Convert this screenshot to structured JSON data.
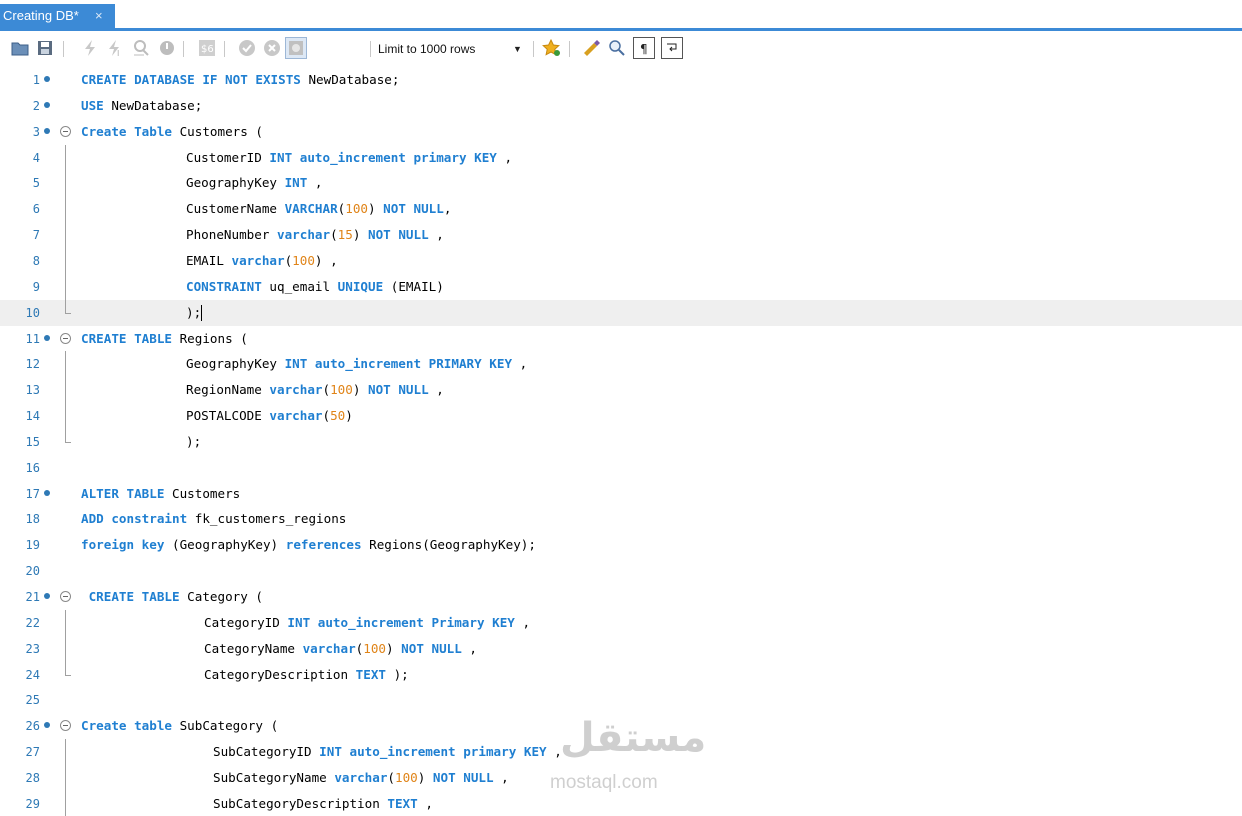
{
  "tab": {
    "title": "Creating DB*",
    "close": "×"
  },
  "toolbar": {
    "limit_label": "Limit to 1000 rows",
    "icons": [
      "open-folder-icon",
      "save-icon",
      "execute-icon",
      "execute-current-icon",
      "explain-icon",
      "stop-icon",
      "toggle-output-icon",
      "commit-icon",
      "rollback-icon",
      "autocommit-icon",
      "limit-rows-select",
      "bookmark-star-icon",
      "beautify-icon",
      "find-icon",
      "invisible-chars-icon",
      "wrap-lines-icon"
    ]
  },
  "editor": {
    "colors": {
      "keyword": "#1f7fd1",
      "number": "#e08418",
      "linenumber": "#2e79b5"
    },
    "lines": [
      {
        "n": "1",
        "dot": true,
        "fold": "",
        "indent": 81,
        "tokens": [
          [
            "k",
            "CREATE DATABASE IF NOT EXISTS"
          ],
          [
            "t",
            " NewDatabase;"
          ]
        ]
      },
      {
        "n": "2",
        "dot": true,
        "fold": "",
        "indent": 81,
        "tokens": [
          [
            "k",
            "USE"
          ],
          [
            "t",
            " NewDatabase;"
          ]
        ]
      },
      {
        "n": "3",
        "dot": true,
        "fold": "open",
        "indent": 81,
        "tokens": [
          [
            "k",
            "Create Table"
          ],
          [
            "t",
            " Customers ("
          ]
        ]
      },
      {
        "n": "4",
        "dot": false,
        "fold": "line",
        "indent": 186,
        "tokens": [
          [
            "t",
            "CustomerID "
          ],
          [
            "k",
            "INT auto_increment primary KEY"
          ],
          [
            "t",
            " ,"
          ]
        ]
      },
      {
        "n": "5",
        "dot": false,
        "fold": "line",
        "indent": 186,
        "tokens": [
          [
            "t",
            "GeographyKey "
          ],
          [
            "k",
            "INT"
          ],
          [
            "t",
            " ,"
          ]
        ]
      },
      {
        "n": "6",
        "dot": false,
        "fold": "line",
        "indent": 186,
        "tokens": [
          [
            "t",
            "CustomerName "
          ],
          [
            "k",
            "VARCHAR"
          ],
          [
            "t",
            "("
          ],
          [
            "n",
            "100"
          ],
          [
            "t",
            ") "
          ],
          [
            "k",
            "NOT NULL"
          ],
          [
            "t",
            ","
          ]
        ]
      },
      {
        "n": "7",
        "dot": false,
        "fold": "line",
        "indent": 186,
        "tokens": [
          [
            "t",
            "PhoneNumber "
          ],
          [
            "k",
            "varchar"
          ],
          [
            "t",
            "("
          ],
          [
            "n",
            "15"
          ],
          [
            "t",
            ") "
          ],
          [
            "k",
            "NOT NULL"
          ],
          [
            "t",
            " ,"
          ]
        ]
      },
      {
        "n": "8",
        "dot": false,
        "fold": "line",
        "indent": 186,
        "tokens": [
          [
            "t",
            "EMAIL "
          ],
          [
            "k",
            "varchar"
          ],
          [
            "t",
            "("
          ],
          [
            "n",
            "100"
          ],
          [
            "t",
            ") ,"
          ]
        ]
      },
      {
        "n": "9",
        "dot": false,
        "fold": "line",
        "indent": 186,
        "tokens": [
          [
            "k",
            "CONSTRAINT"
          ],
          [
            "t",
            " uq_email "
          ],
          [
            "k",
            "UNIQUE"
          ],
          [
            "t",
            " (EMAIL)"
          ]
        ]
      },
      {
        "n": "10",
        "dot": false,
        "fold": "end",
        "indent": 186,
        "active": true,
        "caret": true,
        "tokens": [
          [
            "t",
            ");"
          ]
        ]
      },
      {
        "n": "11",
        "dot": true,
        "fold": "open",
        "indent": 81,
        "tokens": [
          [
            "k",
            "CREATE TABLE"
          ],
          [
            "t",
            " Regions ("
          ]
        ]
      },
      {
        "n": "12",
        "dot": false,
        "fold": "line",
        "indent": 186,
        "tokens": [
          [
            "t",
            "GeographyKey "
          ],
          [
            "k",
            "INT auto_increment PRIMARY KEY"
          ],
          [
            "t",
            " ,"
          ]
        ]
      },
      {
        "n": "13",
        "dot": false,
        "fold": "line",
        "indent": 186,
        "tokens": [
          [
            "t",
            "RegionName "
          ],
          [
            "k",
            "varchar"
          ],
          [
            "t",
            "("
          ],
          [
            "n",
            "100"
          ],
          [
            "t",
            ") "
          ],
          [
            "k",
            "NOT NULL"
          ],
          [
            "t",
            " ,"
          ]
        ]
      },
      {
        "n": "14",
        "dot": false,
        "fold": "line",
        "indent": 186,
        "tokens": [
          [
            "t",
            "POSTALCODE "
          ],
          [
            "k",
            "varchar"
          ],
          [
            "t",
            "("
          ],
          [
            "n",
            "50"
          ],
          [
            "t",
            ")"
          ]
        ]
      },
      {
        "n": "15",
        "dot": false,
        "fold": "end",
        "indent": 186,
        "tokens": [
          [
            "t",
            ");"
          ]
        ]
      },
      {
        "n": "16",
        "dot": false,
        "fold": "",
        "indent": 81,
        "tokens": []
      },
      {
        "n": "17",
        "dot": true,
        "fold": "",
        "indent": 81,
        "tokens": [
          [
            "k",
            "ALTER TABLE"
          ],
          [
            "t",
            " Customers"
          ]
        ]
      },
      {
        "n": "18",
        "dot": false,
        "fold": "",
        "indent": 81,
        "tokens": [
          [
            "k",
            "ADD constraint"
          ],
          [
            "t",
            " fk_customers_regions"
          ]
        ]
      },
      {
        "n": "19",
        "dot": false,
        "fold": "",
        "indent": 81,
        "tokens": [
          [
            "k",
            "foreign key"
          ],
          [
            "t",
            " (GeographyKey) "
          ],
          [
            "k",
            "references"
          ],
          [
            "t",
            " Regions(GeographyKey);"
          ]
        ]
      },
      {
        "n": "20",
        "dot": false,
        "fold": "",
        "indent": 81,
        "tokens": []
      },
      {
        "n": "21",
        "dot": true,
        "fold": "open",
        "indent": 81,
        "tokens": [
          [
            "t",
            " "
          ],
          [
            "k",
            "CREATE TABLE"
          ],
          [
            "t",
            " Category ("
          ]
        ]
      },
      {
        "n": "22",
        "dot": false,
        "fold": "line",
        "indent": 204,
        "tokens": [
          [
            "t",
            "CategoryID "
          ],
          [
            "k",
            "INT auto_increment Primary KEY"
          ],
          [
            "t",
            " ,"
          ]
        ]
      },
      {
        "n": "23",
        "dot": false,
        "fold": "line",
        "indent": 204,
        "tokens": [
          [
            "t",
            "CategoryName "
          ],
          [
            "k",
            "varchar"
          ],
          [
            "t",
            "("
          ],
          [
            "n",
            "100"
          ],
          [
            "t",
            ") "
          ],
          [
            "k",
            "NOT NULL"
          ],
          [
            "t",
            " ,"
          ]
        ]
      },
      {
        "n": "24",
        "dot": false,
        "fold": "end",
        "indent": 204,
        "tokens": [
          [
            "t",
            "CategoryDescription "
          ],
          [
            "k",
            "TEXT"
          ],
          [
            "t",
            " );"
          ]
        ]
      },
      {
        "n": "25",
        "dot": false,
        "fold": "",
        "indent": 81,
        "tokens": []
      },
      {
        "n": "26",
        "dot": true,
        "fold": "open",
        "indent": 81,
        "tokens": [
          [
            "k",
            "Create table"
          ],
          [
            "t",
            " SubCategory ("
          ]
        ]
      },
      {
        "n": "27",
        "dot": false,
        "fold": "line",
        "indent": 213,
        "tokens": [
          [
            "t",
            "SubCategoryID "
          ],
          [
            "k",
            "INT auto_increment primary KEY"
          ],
          [
            "t",
            " ,"
          ]
        ]
      },
      {
        "n": "28",
        "dot": false,
        "fold": "line",
        "indent": 213,
        "tokens": [
          [
            "t",
            "SubCategoryName "
          ],
          [
            "k",
            "varchar"
          ],
          [
            "t",
            "("
          ],
          [
            "n",
            "100"
          ],
          [
            "t",
            ") "
          ],
          [
            "k",
            "NOT NULL"
          ],
          [
            "t",
            " ,"
          ]
        ]
      },
      {
        "n": "29",
        "dot": false,
        "fold": "line",
        "indent": 213,
        "tokens": [
          [
            "t",
            "SubCategoryDescription "
          ],
          [
            "k",
            "TEXT"
          ],
          [
            "t",
            " ,"
          ]
        ]
      }
    ]
  },
  "watermark": {
    "arabic": "مستقل",
    "latin": "mostaql.com"
  }
}
